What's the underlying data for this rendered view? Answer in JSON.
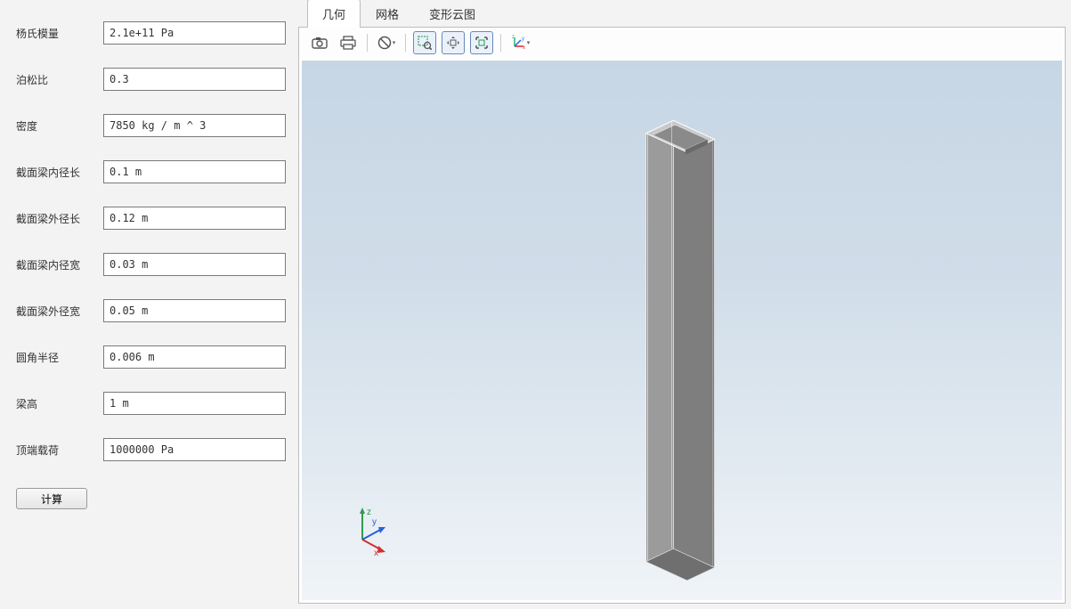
{
  "form": {
    "fields": [
      {
        "label": "杨氏模量",
        "value": "2.1e+11 Pa"
      },
      {
        "label": "泊松比",
        "value": "0.3"
      },
      {
        "label": "密度",
        "value": "7850 kg / m ^ 3"
      },
      {
        "label": "截面梁内径长",
        "value": "0.1 m"
      },
      {
        "label": "截面梁外径长",
        "value": "0.12 m"
      },
      {
        "label": "截面梁内径宽",
        "value": "0.03 m"
      },
      {
        "label": "截面梁外径宽",
        "value": "0.05 m"
      },
      {
        "label": "圆角半径",
        "value": "0.006 m"
      },
      {
        "label": "梁高",
        "value": "1 m"
      },
      {
        "label": "顶端载荷",
        "value": "1000000 Pa"
      }
    ],
    "compute_label": "计算"
  },
  "tabs": {
    "items": [
      {
        "label": "几何",
        "active": true
      },
      {
        "label": "网格",
        "active": false
      },
      {
        "label": "变形云图",
        "active": false
      }
    ]
  },
  "toolbar": {
    "icons": [
      "camera-icon",
      "print-icon",
      "prohibit-icon",
      "zoom-box-icon",
      "pan-icon",
      "zoom-extents-icon",
      "axes-icon"
    ]
  },
  "axes": {
    "x": "x",
    "y": "y",
    "z": "z"
  }
}
